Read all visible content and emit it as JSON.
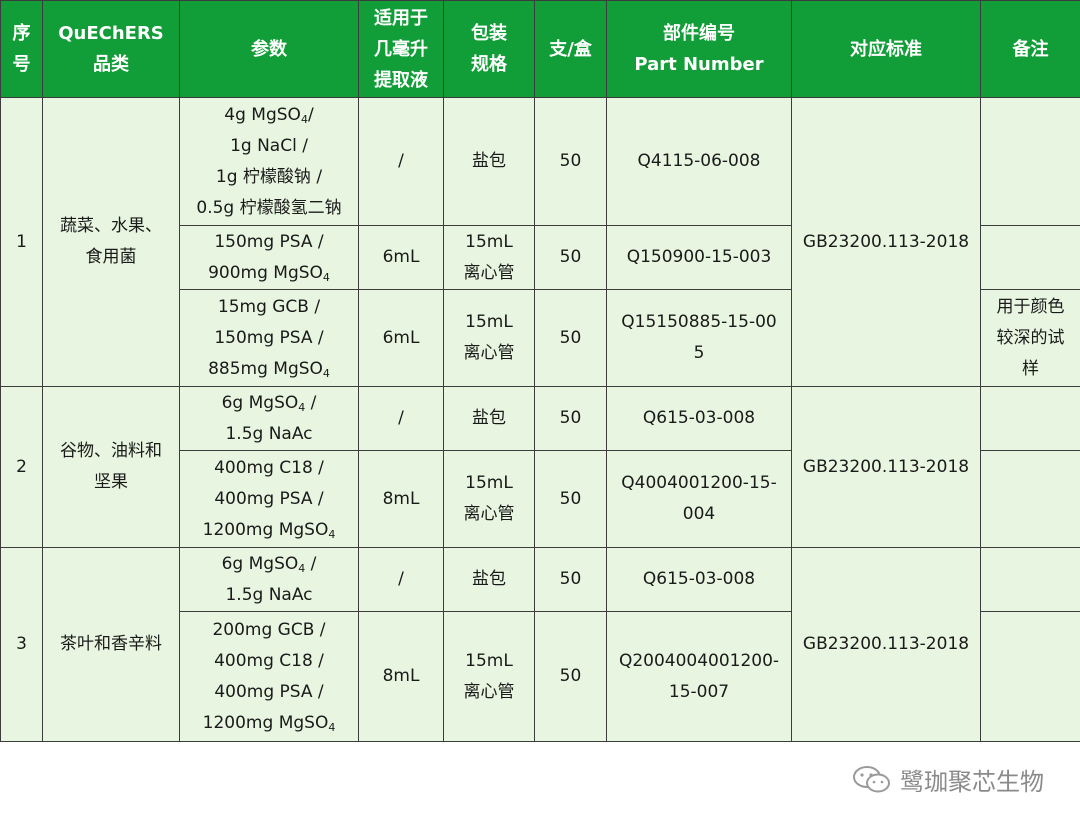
{
  "headers": {
    "index": [
      "序",
      "号"
    ],
    "category": [
      "QuEChERS",
      "品类"
    ],
    "params": "参数",
    "volume": [
      "适用于",
      "几毫升",
      "提取液"
    ],
    "package": [
      "包装",
      "规格"
    ],
    "qty": "支/盒",
    "part": [
      "部件编号",
      "Part Number"
    ],
    "standard": "对应标准",
    "note": "备注"
  },
  "groups": [
    {
      "index": "1",
      "category": [
        "蔬菜、水果、",
        "食用菌"
      ],
      "standard": "GB23200.113-2018",
      "rows": [
        {
          "params": [
            {
              "text": "4g MgSO",
              "sub": "4",
              "after": "/"
            },
            {
              "text": "1g NaCl /"
            },
            {
              "text": "1g  柠檬酸钠  /"
            },
            {
              "text": "0.5g  柠檬酸氢二钠"
            }
          ],
          "volume": "/",
          "package": [
            "盐包"
          ],
          "qty": "50",
          "part": [
            "Q4115-06-008"
          ],
          "note": []
        },
        {
          "params": [
            {
              "text": "150mg PSA /"
            },
            {
              "text": "900mg MgSO",
              "sub": "4"
            }
          ],
          "volume": "6mL",
          "package": [
            "15mL",
            "离心管"
          ],
          "qty": "50",
          "part": [
            "Q150900-15-003"
          ],
          "note": []
        },
        {
          "params": [
            {
              "text": "15mg GCB /"
            },
            {
              "text": "150mg PSA /"
            },
            {
              "text": "885mg MgSO",
              "sub": "4"
            }
          ],
          "volume": "6mL",
          "package": [
            "15mL",
            "离心管"
          ],
          "qty": "50",
          "part": [
            "Q15150885-15-00",
            "5"
          ],
          "note": [
            "用于颜色",
            "较深的试",
            "样"
          ]
        }
      ]
    },
    {
      "index": "2",
      "category": [
        "谷物、油料和",
        "坚果"
      ],
      "standard": "GB23200.113-2018",
      "rows": [
        {
          "params": [
            {
              "text": "6g MgSO",
              "sub": "4",
              "after": " /"
            },
            {
              "text": "1.5g NaAc"
            }
          ],
          "volume": "/",
          "package": [
            "盐包"
          ],
          "qty": "50",
          "part": [
            "Q615-03-008"
          ],
          "note": []
        },
        {
          "params": [
            {
              "text": "400mg C18 /"
            },
            {
              "text": "400mg PSA /"
            },
            {
              "text": "1200mg MgSO",
              "sub": "4"
            }
          ],
          "volume": "8mL",
          "package": [
            "15mL",
            "离心管"
          ],
          "qty": "50",
          "part": [
            "Q4004001200-15-",
            "004"
          ],
          "note": []
        }
      ]
    },
    {
      "index": "3",
      "category": [
        "茶叶和香辛料"
      ],
      "standard": "GB23200.113-2018",
      "rows": [
        {
          "params": [
            {
              "text": "6g MgSO",
              "sub": "4",
              "after": " /"
            },
            {
              "text": "1.5g NaAc"
            }
          ],
          "volume": "/",
          "package": [
            "盐包"
          ],
          "qty": "50",
          "part": [
            "Q615-03-008"
          ],
          "note": []
        },
        {
          "params": [
            {
              "text": "200mg GCB /"
            },
            {
              "text": "400mg C18 /"
            },
            {
              "text": "400mg PSA /"
            },
            {
              "text": "1200mg MgSO",
              "sub": "4"
            }
          ],
          "volume": "8mL",
          "package": [
            "15mL",
            "离心管"
          ],
          "qty": "50",
          "part": [
            "Q2004004001200-",
            "15-007"
          ],
          "note": []
        }
      ]
    }
  ],
  "watermark": {
    "text": "鹭珈聚芯生物",
    "icon": "wechat-icon"
  },
  "colors": {
    "header_bg": "#119d37",
    "body_bg": "#e8f6e1",
    "border": "#3c3c3c",
    "watermark": "#8a8a8a"
  }
}
